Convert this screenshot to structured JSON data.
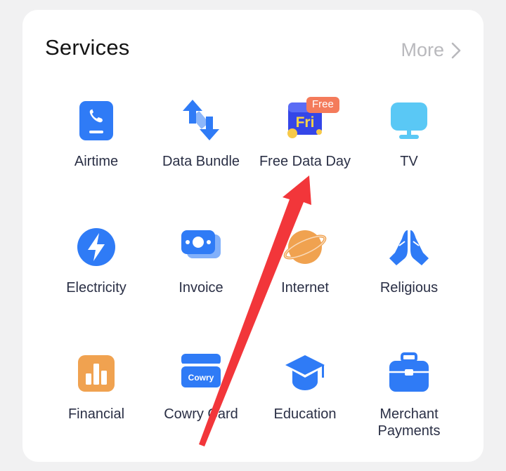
{
  "header": {
    "title": "Services",
    "more_label": "More"
  },
  "services": [
    {
      "label": "Airtime",
      "icon": "phone-icon"
    },
    {
      "label": "Data Bundle",
      "icon": "up-down-arrows-icon"
    },
    {
      "label": "Free Data Day",
      "icon": "fri-data-day-icon",
      "badge": "Free",
      "icon_text": "Fri"
    },
    {
      "label": "TV",
      "icon": "tv-icon"
    },
    {
      "label": "Electricity",
      "icon": "lightning-icon"
    },
    {
      "label": "Invoice",
      "icon": "invoice-cash-icon"
    },
    {
      "label": "Internet",
      "icon": "planet-icon"
    },
    {
      "label": "Religious",
      "icon": "praying-hands-icon"
    },
    {
      "label": "Financial",
      "icon": "bar-chart-icon"
    },
    {
      "label": "Cowry Card",
      "icon": "cowry-card-icon",
      "icon_text": "Cowry"
    },
    {
      "label": "Education",
      "icon": "graduation-cap-icon"
    },
    {
      "label": "Merchant\nPayments",
      "icon": "briefcase-icon"
    }
  ],
  "colors": {
    "blue": "#2f7bf6",
    "light_blue": "#5ac8f5",
    "orange": "#f0a250",
    "badge": "#f47b5b",
    "annotation_arrow": "#f2363a"
  }
}
